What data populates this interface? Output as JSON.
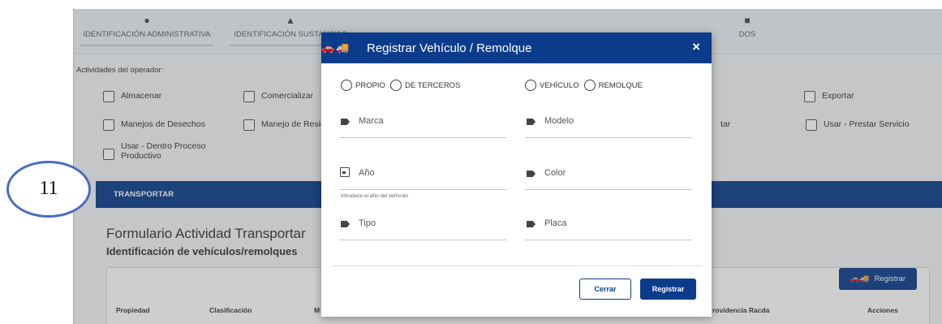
{
  "steps": [
    {
      "label": "IDENTIFICACIÓN ADMINISTRATIVA",
      "icon": "person-icon"
    },
    {
      "label": "IDENTIFICACIÓN SUSTANCIAS",
      "icon": "flask-icon"
    },
    {
      "label": "",
      "icon": "dots-icon"
    },
    {
      "label": "",
      "icon": "compass-icon"
    },
    {
      "label": "",
      "icon": "building-icon"
    },
    {
      "label": "DOS",
      "icon": "folder-icon"
    }
  ],
  "activities_label": "Actividades del operador:",
  "activities": {
    "almacenar": "Almacenar",
    "comercializar": "Comercializar",
    "exportar": "Exportar",
    "manejos_desechos": "Manejos de Desechos",
    "manejo_residuos": "Manejo de Residu",
    "tar": "tar",
    "usar_prestar": "Usar - Prestar Servicio",
    "usar_dentro_1": "Usar - Dentro Proceso",
    "usar_dentro_2": "Productivo"
  },
  "band_tab": "TRANSPORTAR",
  "form_title": "Formulario Actividad Transportar",
  "form_subtitle": "Identificación de vehículos/remolques",
  "register_bg_button": "Registrar",
  "table_headers": {
    "propiedad": "Propiedad",
    "clasificacion": "Clasificación",
    "m": "M",
    "providencia": "rovidencia Racda",
    "acciones": "Acciones"
  },
  "modal": {
    "title": "Registrar Vehículo / Remolque",
    "close": "×",
    "radio_propio": "PROPIO",
    "radio_terceros": "DE TERCEROS",
    "radio_vehiculo": "VEHÍCULO",
    "radio_remolque": "REMOLQUE",
    "fields": {
      "marca": "Marca",
      "modelo": "Modelo",
      "anio": "Año",
      "color": "Color",
      "tipo": "Tipo",
      "placa": "Placa"
    },
    "anio_hint": "Introduce el año del vehículo",
    "cerrar": "Cerrar",
    "registrar": "Registrar"
  },
  "callout": "11",
  "colors": {
    "primary": "#0b3c8c",
    "callout_ring": "#4a6cc0"
  }
}
